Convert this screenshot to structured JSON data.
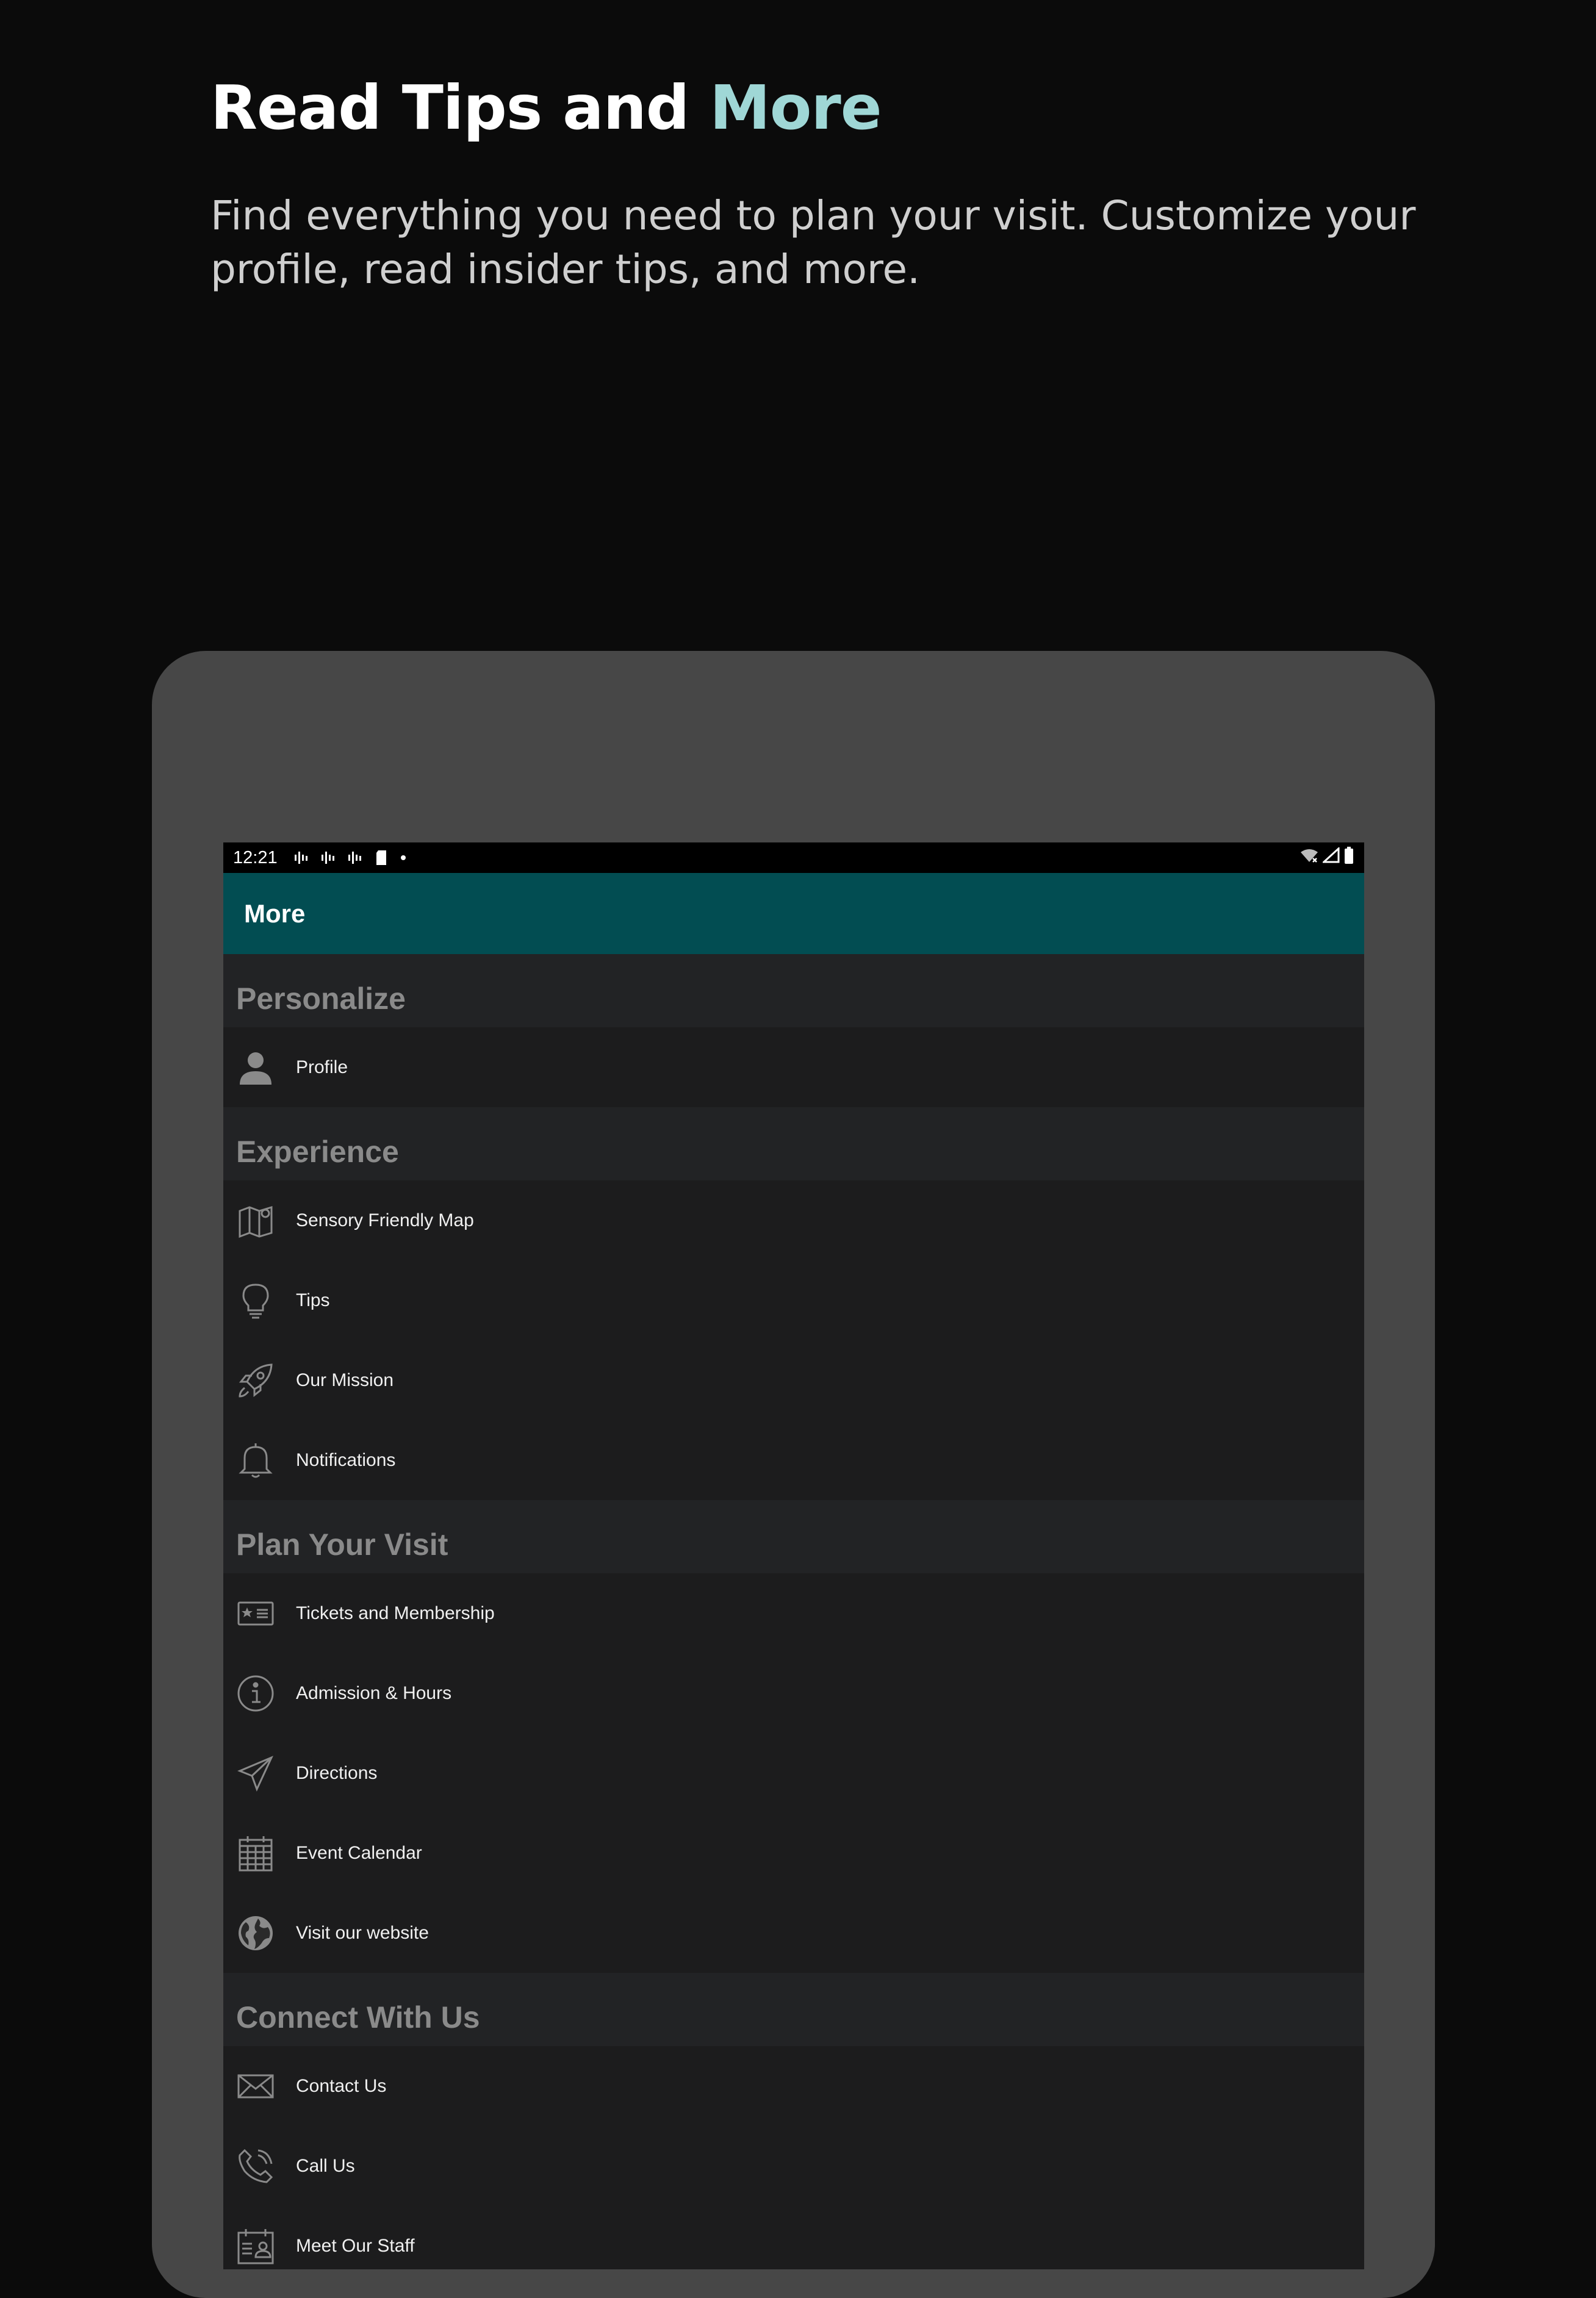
{
  "headline": {
    "main": "Read Tips and ",
    "accent": "More"
  },
  "subtitle": "Find everything you need to plan your visit. Customize your profile, read insider tips, and more.",
  "statusbar": {
    "time": "12:21"
  },
  "appbar": {
    "title": "More"
  },
  "sections": [
    {
      "title": "Personalize",
      "items": [
        {
          "label": "Profile",
          "icon": "profile-icon"
        }
      ]
    },
    {
      "title": "Experience",
      "items": [
        {
          "label": "Sensory Friendly Map",
          "icon": "map-icon"
        },
        {
          "label": "Tips",
          "icon": "lightbulb-icon"
        },
        {
          "label": "Our Mission",
          "icon": "rocket-icon"
        },
        {
          "label": "Notifications",
          "icon": "bell-icon"
        }
      ]
    },
    {
      "title": "Plan Your Visit",
      "items": [
        {
          "label": "Tickets and Membership",
          "icon": "ticket-icon"
        },
        {
          "label": "Admission & Hours",
          "icon": "info-icon"
        },
        {
          "label": "Directions",
          "icon": "paper-plane-icon"
        },
        {
          "label": "Event Calendar",
          "icon": "calendar-icon"
        },
        {
          "label": "Visit our website",
          "icon": "globe-icon"
        }
      ]
    },
    {
      "title": "Connect With Us",
      "items": [
        {
          "label": "Contact Us",
          "icon": "envelope-icon"
        },
        {
          "label": "Call Us",
          "icon": "phone-icon"
        },
        {
          "label": "Meet Our Staff",
          "icon": "staff-id-icon"
        }
      ]
    }
  ],
  "colors": {
    "accent": "#9fd7d6",
    "appbar": "#024d52",
    "section_header_text": "#8a8a8a"
  }
}
